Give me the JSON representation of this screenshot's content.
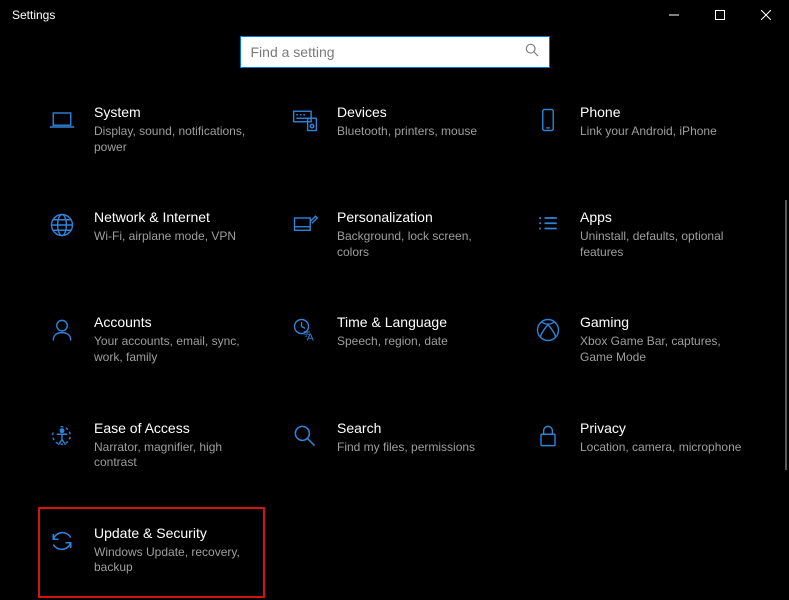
{
  "window": {
    "title": "Settings"
  },
  "search": {
    "placeholder": "Find a setting"
  },
  "tiles": [
    {
      "title": "System",
      "desc": "Display, sound, notifications, power"
    },
    {
      "title": "Devices",
      "desc": "Bluetooth, printers, mouse"
    },
    {
      "title": "Phone",
      "desc": "Link your Android, iPhone"
    },
    {
      "title": "Network & Internet",
      "desc": "Wi-Fi, airplane mode, VPN"
    },
    {
      "title": "Personalization",
      "desc": "Background, lock screen, colors"
    },
    {
      "title": "Apps",
      "desc": "Uninstall, defaults, optional features"
    },
    {
      "title": "Accounts",
      "desc": "Your accounts, email, sync, work, family"
    },
    {
      "title": "Time & Language",
      "desc": "Speech, region, date"
    },
    {
      "title": "Gaming",
      "desc": "Xbox Game Bar, captures, Game Mode"
    },
    {
      "title": "Ease of Access",
      "desc": "Narrator, magnifier, high contrast"
    },
    {
      "title": "Search",
      "desc": "Find my files, permissions"
    },
    {
      "title": "Privacy",
      "desc": "Location, camera, microphone"
    },
    {
      "title": "Update & Security",
      "desc": "Windows Update, recovery, backup"
    }
  ]
}
